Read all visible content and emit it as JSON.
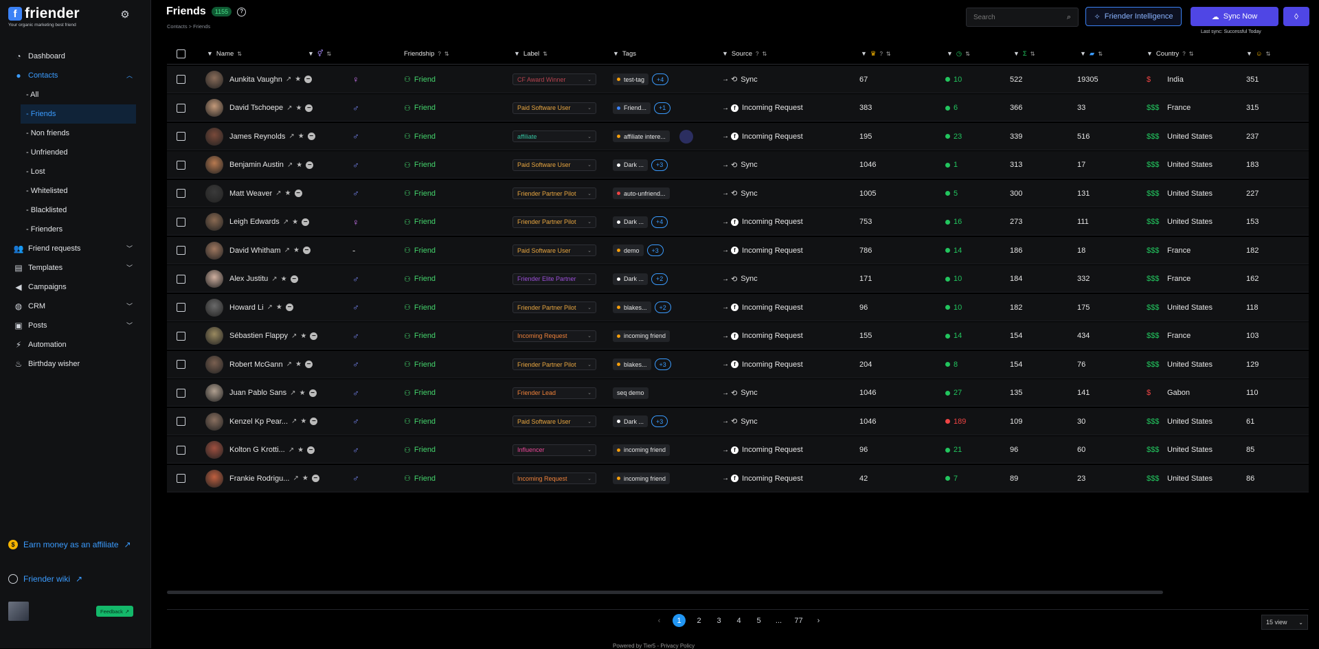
{
  "sidebar": {
    "logo_letter": "f",
    "logo_text": "friender",
    "tagline": "Your organic marketing best friend",
    "nav": [
      {
        "label": "Dashboard",
        "icon": "chart-pie-icon"
      },
      {
        "label": "Contacts",
        "icon": "user-icon"
      },
      {
        "label": "Friend requests",
        "icon": "users-icon"
      },
      {
        "label": "Templates",
        "icon": "template-icon"
      },
      {
        "label": "Campaigns",
        "icon": "megaphone-icon"
      },
      {
        "label": "CRM",
        "icon": "crm-icon"
      },
      {
        "label": "Posts",
        "icon": "posts-icon"
      },
      {
        "label": "Automation",
        "icon": "bolt-icon"
      },
      {
        "label": "Birthday wisher",
        "icon": "cake-icon"
      }
    ],
    "contacts_sub": [
      "- All",
      "- Friends",
      "- Non friends",
      "- Unfriended",
      "- Lost",
      "- Whitelisted",
      "- Blacklisted",
      "- Frienders"
    ],
    "affiliate": "Earn money as an affiliate",
    "wiki": "Friender wiki",
    "feedback": "Feedback"
  },
  "header": {
    "title": "Friends",
    "count": "1155",
    "breadcrumb": "Contacts  >  Friends",
    "search_placeholder": "Search",
    "intel_button": "Friender Intelligence",
    "sync_button": "Sync Now",
    "last_sync": "Last sync: Successful Today"
  },
  "columns": {
    "name": "Name",
    "friendship": "Friendship",
    "label": "Label",
    "tags": "Tags",
    "source": "Source",
    "country": "Country"
  },
  "rows": [
    {
      "name": "Aunkita Vaughn",
      "gender": "f",
      "friendship": "Friend",
      "label": "CF Award Winner",
      "label_color": "#b8434f",
      "tag": "test-tag",
      "tag_dot": "#f59e0b",
      "more": "+4",
      "source": "Sync",
      "src_type": "sync",
      "c1": "67",
      "c2": "10",
      "c2_color": "#22c55e",
      "c3": "522",
      "c4": "19305",
      "money": "$",
      "money_color": "#ef4444",
      "country": "India",
      "c5": "351"
    },
    {
      "name": "David Tschoepe",
      "gender": "m",
      "friendship": "Friend",
      "label": "Paid Software User",
      "label_color": "#e8a640",
      "tag": "Friend...",
      "tag_dot": "#3b82f6",
      "more": "+1",
      "source": "Incoming Request",
      "src_type": "fb",
      "c1": "383",
      "c2": "6",
      "c2_color": "#22c55e",
      "c3": "366",
      "c4": "33",
      "money": "$$$",
      "money_color": "#22c55e",
      "country": "France",
      "c5": "315"
    },
    {
      "name": "James Reynolds",
      "gender": "m",
      "friendship": "Friend",
      "label": "affiliate",
      "label_color": "#35c2a0",
      "tag": "affiliate intere...",
      "tag_dot": "#f59e0b",
      "more": "",
      "source": "Incoming Request",
      "src_type": "fb",
      "c1": "195",
      "c2": "23",
      "c2_color": "#22c55e",
      "c3": "339",
      "c4": "516",
      "money": "$$$",
      "money_color": "#22c55e",
      "country": "United States",
      "c5": "237"
    },
    {
      "name": "Benjamin Austin",
      "gender": "m",
      "friendship": "Friend",
      "label": "Paid Software User",
      "label_color": "#e8a640",
      "tag": "Dark ...",
      "tag_dot": "#ffffff",
      "more": "+3",
      "source": "Sync",
      "src_type": "sync",
      "c1": "1046",
      "c2": "1",
      "c2_color": "#22c55e",
      "c3": "313",
      "c4": "17",
      "money": "$$$",
      "money_color": "#22c55e",
      "country": "United States",
      "c5": "183"
    },
    {
      "name": "Matt Weaver",
      "gender": "m",
      "friendship": "Friend",
      "label": "Friender Partner Pilot",
      "label_color": "#e8a640",
      "tag": "auto-unfriend...",
      "tag_dot": "#ef4444",
      "more": "",
      "source": "Sync",
      "src_type": "sync",
      "c1": "1005",
      "c2": "5",
      "c2_color": "#22c55e",
      "c3": "300",
      "c4": "131",
      "money": "$$$",
      "money_color": "#22c55e",
      "country": "United States",
      "c5": "227"
    },
    {
      "name": "Leigh Edwards",
      "gender": "f",
      "friendship": "Friend",
      "label": "Friender Partner Pilot",
      "label_color": "#e8a640",
      "tag": "Dark ...",
      "tag_dot": "#ffffff",
      "more": "+4",
      "source": "Incoming Request",
      "src_type": "fb",
      "c1": "753",
      "c2": "16",
      "c2_color": "#22c55e",
      "c3": "273",
      "c4": "111",
      "money": "$$$",
      "money_color": "#22c55e",
      "country": "United States",
      "c5": "153"
    },
    {
      "name": "David Whitham",
      "gender": "-",
      "friendship": "Friend",
      "label": "Paid Software User",
      "label_color": "#e8a640",
      "tag": "demo",
      "tag_dot": "#f59e0b",
      "more": "+3",
      "source": "Incoming Request",
      "src_type": "fb",
      "c1": "786",
      "c2": "14",
      "c2_color": "#22c55e",
      "c3": "186",
      "c4": "18",
      "money": "$$$",
      "money_color": "#22c55e",
      "country": "France",
      "c5": "182"
    },
    {
      "name": "Alex Justitu",
      "gender": "m",
      "friendship": "Friend",
      "label": "Friender Elite Partner",
      "label_color": "#9b4fd8",
      "tag": "Dark ...",
      "tag_dot": "#ffffff",
      "more": "+2",
      "source": "Sync",
      "src_type": "sync",
      "c1": "171",
      "c2": "10",
      "c2_color": "#22c55e",
      "c3": "184",
      "c4": "332",
      "money": "$$$",
      "money_color": "#22c55e",
      "country": "France",
      "c5": "162"
    },
    {
      "name": "Howard Li",
      "gender": "m",
      "friendship": "Friend",
      "label": "Friender Partner Pilot",
      "label_color": "#e8a640",
      "tag": "blakes...",
      "tag_dot": "#f59e0b",
      "more": "+2",
      "source": "Incoming Request",
      "src_type": "fb",
      "c1": "96",
      "c2": "10",
      "c2_color": "#22c55e",
      "c3": "182",
      "c4": "175",
      "money": "$$$",
      "money_color": "#22c55e",
      "country": "United States",
      "c5": "118"
    },
    {
      "name": "Sébastien Flappy",
      "gender": "m",
      "friendship": "Friend",
      "label": "Incoming Request",
      "label_color": "#f0823a",
      "tag": "incoming friend",
      "tag_dot": "#f59e0b",
      "more": "",
      "source": "Incoming Request",
      "src_type": "fb",
      "c1": "155",
      "c2": "14",
      "c2_color": "#22c55e",
      "c3": "154",
      "c4": "434",
      "money": "$$$",
      "money_color": "#22c55e",
      "country": "France",
      "c5": "103"
    },
    {
      "name": "Robert McGann",
      "gender": "m",
      "friendship": "Friend",
      "label": "Friender Partner Pilot",
      "label_color": "#e8a640",
      "tag": "blakes...",
      "tag_dot": "#f59e0b",
      "more": "+3",
      "source": "Incoming Request",
      "src_type": "fb",
      "c1": "204",
      "c2": "8",
      "c2_color": "#22c55e",
      "c3": "154",
      "c4": "76",
      "money": "$$$",
      "money_color": "#22c55e",
      "country": "United States",
      "c5": "129"
    },
    {
      "name": "Juan Pablo Sans",
      "gender": "m",
      "friendship": "Friend",
      "label": "Friender Lead",
      "label_color": "#f0823a",
      "tag": "seq demo",
      "tag_dot": "",
      "more": "",
      "source": "Sync",
      "src_type": "sync",
      "c1": "1046",
      "c2": "27",
      "c2_color": "#22c55e",
      "c3": "135",
      "c4": "141",
      "money": "$",
      "money_color": "#ef4444",
      "country": "Gabon",
      "c5": "110"
    },
    {
      "name": "Kenzel Kp Pear...",
      "gender": "m",
      "friendship": "Friend",
      "label": "Paid Software User",
      "label_color": "#e8a640",
      "tag": "Dark ...",
      "tag_dot": "#ffffff",
      "more": "+3",
      "source": "Sync",
      "src_type": "sync",
      "c1": "1046",
      "c2": "189",
      "c2_color": "#ef4444",
      "c3": "109",
      "c4": "30",
      "money": "$$$",
      "money_color": "#22c55e",
      "country": "United States",
      "c5": "61"
    },
    {
      "name": "Kolton G Krotti...",
      "gender": "m",
      "friendship": "Friend",
      "label": "Influencer",
      "label_color": "#ec4899",
      "tag": "incoming friend",
      "tag_dot": "#f59e0b",
      "more": "",
      "source": "Incoming Request",
      "src_type": "fb",
      "c1": "96",
      "c2": "21",
      "c2_color": "#22c55e",
      "c3": "96",
      "c4": "60",
      "money": "$$$",
      "money_color": "#22c55e",
      "country": "United States",
      "c5": "85"
    },
    {
      "name": "Frankie Rodrigu...",
      "gender": "m",
      "friendship": "Friend",
      "label": "Incoming Request",
      "label_color": "#f0823a",
      "tag": "incoming friend",
      "tag_dot": "#f59e0b",
      "more": "",
      "source": "Incoming Request",
      "src_type": "fb",
      "c1": "42",
      "c2": "7",
      "c2_color": "#22c55e",
      "c3": "89",
      "c4": "23",
      "money": "$$$",
      "money_color": "#22c55e",
      "country": "United States",
      "c5": "86"
    }
  ],
  "pagination": {
    "pages": [
      "1",
      "2",
      "3",
      "4",
      "5",
      "...",
      "77"
    ],
    "current": "1",
    "per_page": "15 view"
  },
  "footer": {
    "powered_prefix": "Powered by ",
    "powered_link": "Tier5",
    "privacy": " - Privacy Policy"
  },
  "colors": {
    "accent": "#3b9cff",
    "friend_green": "#44d46c",
    "brand_purple": "#4f46e5"
  }
}
